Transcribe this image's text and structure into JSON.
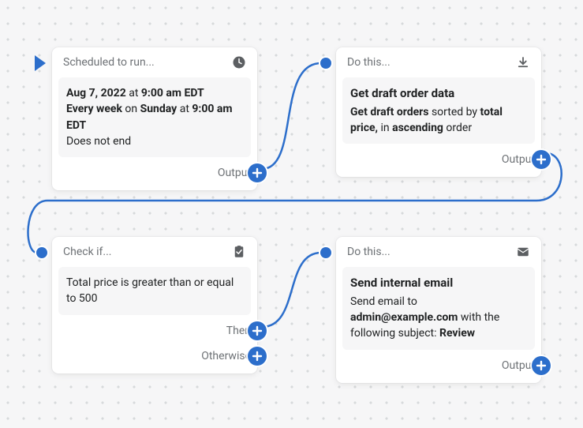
{
  "nodes": {
    "schedule": {
      "header": "Scheduled to run...",
      "date": "Aug 7, 2022",
      "at_label": " at ",
      "time": "9:00 am EDT",
      "every_week": "Every week",
      "on_label": " on ",
      "day": "Sunday",
      "at_label2": " at ",
      "time2": "9:00 am EDT",
      "end_text": "Does not end",
      "output_label": "Output"
    },
    "get_orders": {
      "header": "Do this...",
      "heading": "Get draft order data",
      "l1a": "Get draft orders",
      "l1b": " sorted by ",
      "l1c": "total price,",
      "l1d": " in ",
      "l1e": "ascending",
      "l1f": " order",
      "output_label": "Output"
    },
    "check": {
      "header": "Check if...",
      "body_text": "Total price is greater than or equal to 500",
      "then_label": "Then",
      "otherwise_label": "Otherwise"
    },
    "email": {
      "header": "Do this...",
      "heading": "Send internal email",
      "l1": "Send email to ",
      "addr": "admin@example.com",
      "l2": " with the following subject: ",
      "subj": "Review",
      "output_label": "Output"
    }
  }
}
